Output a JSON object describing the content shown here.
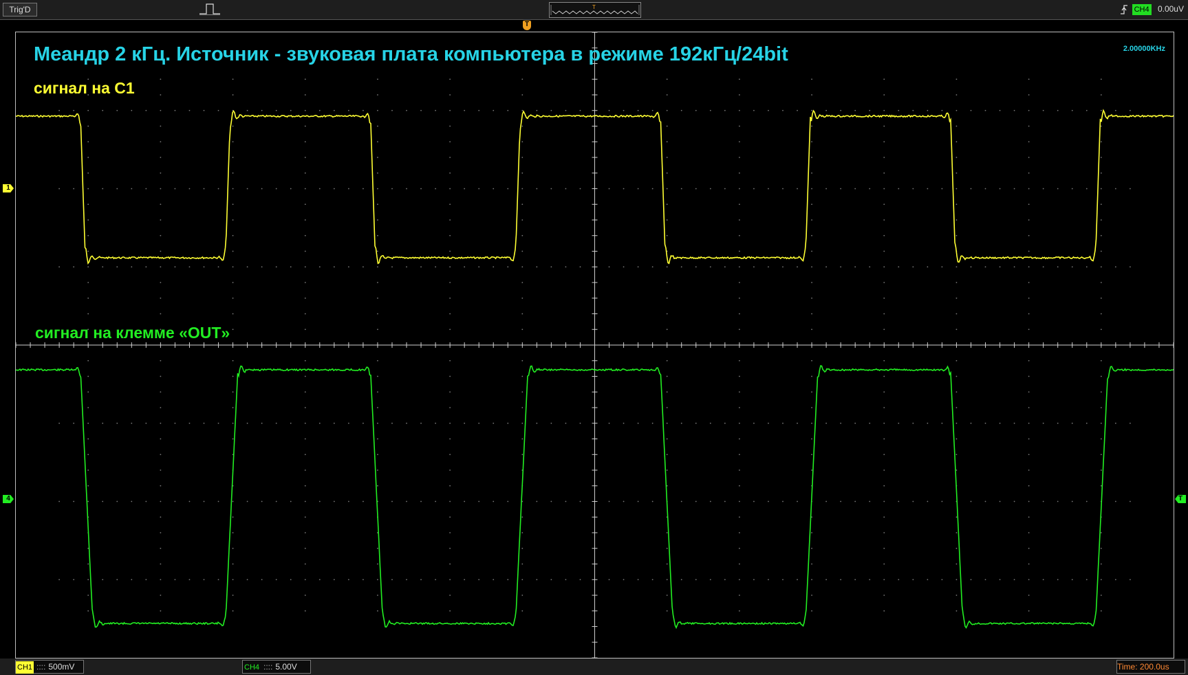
{
  "top_bar": {
    "trigger_status": "Trig'D",
    "trigger_source": "CH4",
    "trigger_level": "0.00uV"
  },
  "screen": {
    "title": "Меандр 2 кГц. Источник - звуковая плата компьютера в режиме 192кГц/24bit",
    "frequency": "2.00000KHz",
    "ch1_label": "сигнал на С1",
    "ch4_label": "сигнал на клемме «OUT»",
    "trigger_marker": "T",
    "ch1_marker": "1",
    "ch4_marker": "4",
    "level_marker": "T"
  },
  "bottom_bar": {
    "ch1_name": "CH1",
    "ch1_coupling": "::::",
    "ch1_scale": "500mV",
    "ch4_name": "CH4",
    "ch4_coupling": "::::",
    "ch4_scale": "5.00V",
    "timebase": "Time: 200.0us"
  },
  "colors": {
    "ch1": "#ffff33",
    "ch4": "#22ee22",
    "title": "#27d3e6",
    "grid": "#7a7a7a"
  }
}
